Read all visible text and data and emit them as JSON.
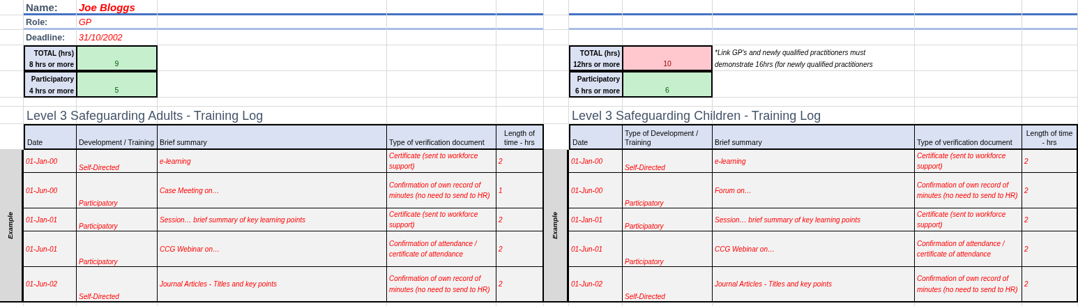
{
  "panels": [
    {
      "fields": [
        {
          "kind": "name",
          "label": "Name:",
          "value": "Joe Bloggs"
        },
        {
          "kind": "detail",
          "label": "Role:",
          "value": "GP"
        },
        {
          "kind": "detail",
          "label": "Deadline:",
          "value": "31/10/2002"
        }
      ],
      "totals": [
        {
          "label": "TOTAL (hrs)",
          "requirement": "8 hrs or more",
          "value": "9",
          "met": true
        },
        {
          "label": "Participatory",
          "requirement": "4 hrs or more",
          "value": "5",
          "met": true
        }
      ],
      "log": {
        "title": "Level 3 Safeguarding Adults - Training Log",
        "side_label": "Example",
        "columns": [
          "Date",
          "Development / Training",
          "Brief summary",
          "Type of verification document",
          "Length of time - hrs"
        ],
        "rows": [
          {
            "date": "01-Jan-00",
            "type": "Self-Directed",
            "summary": "e-learning",
            "document": "Certificate (sent to workforce support)",
            "hours": "2"
          },
          {
            "date": "01-Jun-00",
            "type": "Participatory",
            "summary": "Case Meeting on…",
            "document": "Confirmation of own record of minutes (no need to send to HR)",
            "hours": "1"
          },
          {
            "date": "01-Jan-01",
            "type": "Participatory",
            "summary": "Session… brief summary of key learning points",
            "document": "Certificate (sent to workforce support)",
            "hours": "2"
          },
          {
            "date": "01-Jun-01",
            "type": "Participatory",
            "summary": "CCG Webinar on…",
            "document": "Confirmation of attendance / certificate of attendance",
            "hours": "2"
          },
          {
            "date": "01-Jun-02",
            "type": "Self-Directed",
            "summary": "Journal Articles - Titles and key points",
            "document": "Confirmation of own record of minutes (no need to send to HR)",
            "hours": "2"
          }
        ]
      }
    },
    {
      "totals": [
        {
          "label": "TOTAL (hrs)",
          "requirement": "12hrs or more",
          "value": "10",
          "met": false
        },
        {
          "label": "Participatory",
          "requirement": "6 hrs or more",
          "value": "6",
          "met": true
        }
      ],
      "note": "*Link GP's and newly qualified practitioners must\ndemonstrate 16hrs (for newly qualified practitioners",
      "log": {
        "title": "Level 3 Safeguarding Children - Training Log",
        "side_label": "Example",
        "columns": [
          "Date",
          "Type of Development / Training",
          "Brief summary",
          "Type of verification document",
          "Length of time - hrs"
        ],
        "rows": [
          {
            "date": "01-Jan-00",
            "type": "Self-Directed",
            "summary": "e-learning",
            "document": "Certificate (sent to workforce support)",
            "hours": "2"
          },
          {
            "date": "01-Jun-00",
            "type": "Participatory",
            "summary": "Forum on…",
            "document": "Confirmation of own record of minutes (no need to send to HR)",
            "hours": "2"
          },
          {
            "date": "01-Jan-01",
            "type": "Participatory",
            "summary": "Session… brief summary of key learning points",
            "document": "Certificate (sent to workforce support)",
            "hours": "2"
          },
          {
            "date": "01-Jun-01",
            "type": "Participatory",
            "summary": "CCG Webinar on…",
            "document": "Confirmation of attendance / certificate of attendance",
            "hours": "2"
          },
          {
            "date": "01-Jun-02",
            "type": "Self-Directed",
            "summary": "Journal Articles - Titles and key points",
            "document": "Confirmation of own record of minutes (no need to send to HR)",
            "hours": "2"
          }
        ]
      }
    }
  ]
}
